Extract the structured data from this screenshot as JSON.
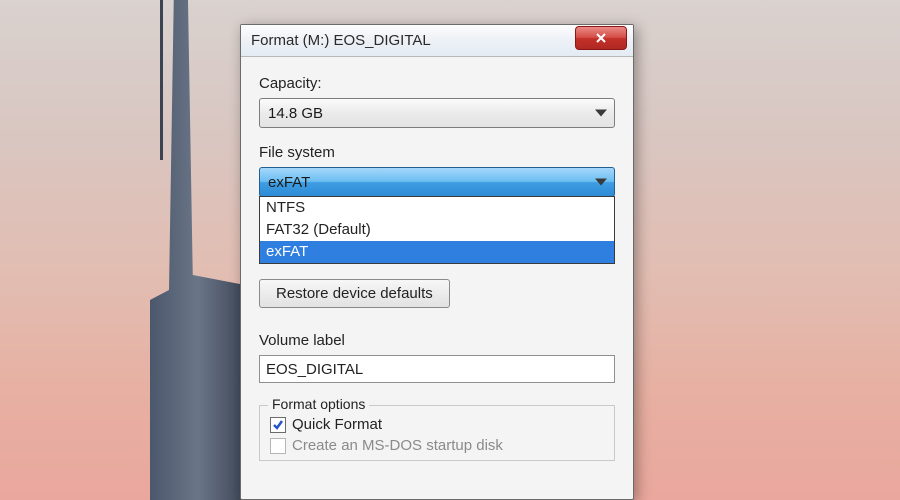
{
  "window": {
    "title": "Format (M:) EOS_DIGITAL"
  },
  "capacity": {
    "label": "Capacity:",
    "value": "14.8 GB"
  },
  "filesystem": {
    "label": "File system",
    "value": "exFAT",
    "options": {
      "0": "NTFS",
      "1": "FAT32 (Default)",
      "2": "exFAT"
    }
  },
  "restore": {
    "label": "Restore device defaults"
  },
  "volume": {
    "label": "Volume label",
    "value": "EOS_DIGITAL"
  },
  "format_options": {
    "legend": "Format options",
    "quick_format": "Quick Format",
    "msdos": "Create an MS-DOS startup disk"
  }
}
